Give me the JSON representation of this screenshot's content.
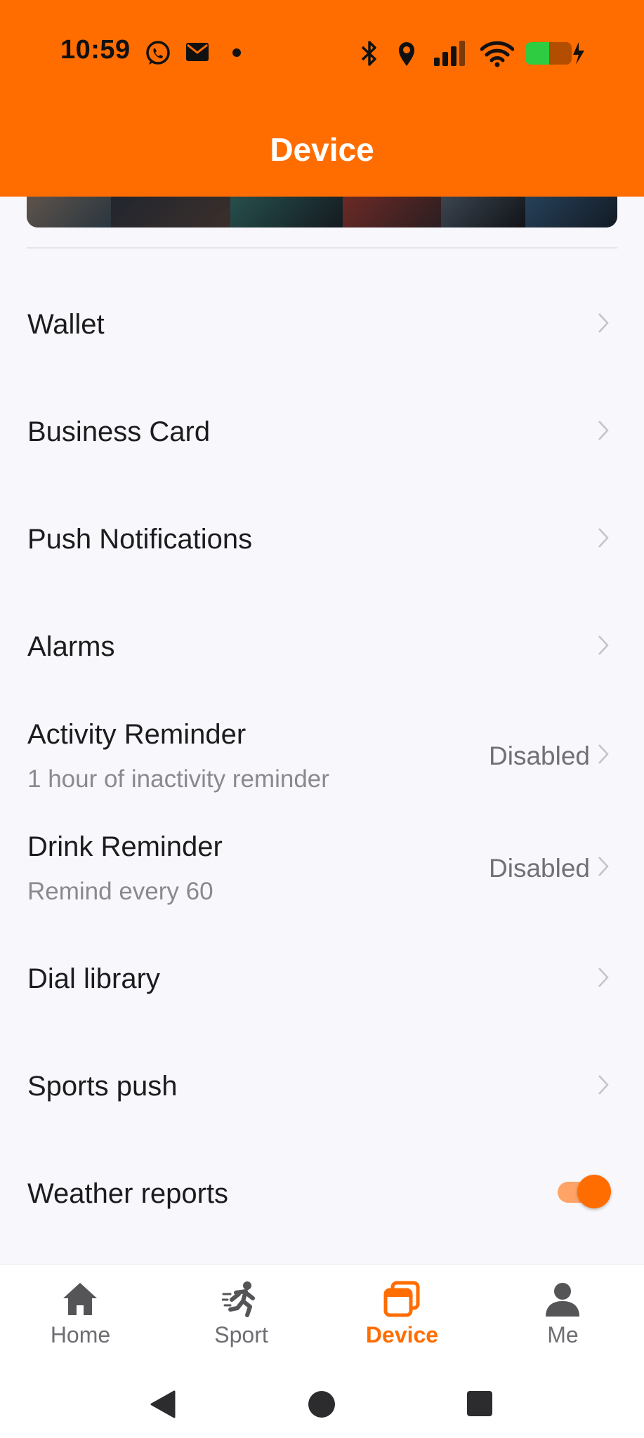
{
  "status_bar": {
    "time": "10:59",
    "icons": [
      "whatsapp-icon",
      "mail-icon",
      "dot-icon",
      "bluetooth-icon",
      "location-icon",
      "signal-icon",
      "wifi-icon",
      "battery-icon"
    ],
    "battery_color": "#2ecc40"
  },
  "header": {
    "title": "Device",
    "background": "#ff6d00"
  },
  "settings": {
    "items": [
      {
        "title": "Wallet"
      },
      {
        "title": "Business Card"
      },
      {
        "title": "Push Notifications"
      },
      {
        "title": "Alarms"
      },
      {
        "title": "Activity Reminder",
        "subtitle": "1 hour of inactivity reminder",
        "value": "Disabled"
      },
      {
        "title": "Drink Reminder",
        "subtitle": "Remind every 60",
        "value": "Disabled"
      },
      {
        "title": "Dial library"
      },
      {
        "title": "Sports push"
      },
      {
        "title": "Weather reports",
        "toggle": true
      }
    ]
  },
  "tabbar": {
    "tabs": [
      {
        "label": "Home",
        "icon": "home-icon"
      },
      {
        "label": "Sport",
        "icon": "running-icon"
      },
      {
        "label": "Device",
        "icon": "device-icon",
        "active": true
      },
      {
        "label": "Me",
        "icon": "person-icon"
      }
    ],
    "active_color": "#ff6d00"
  },
  "navbar": {
    "buttons": [
      "back-icon",
      "home-circle-icon",
      "recents-icon"
    ]
  }
}
